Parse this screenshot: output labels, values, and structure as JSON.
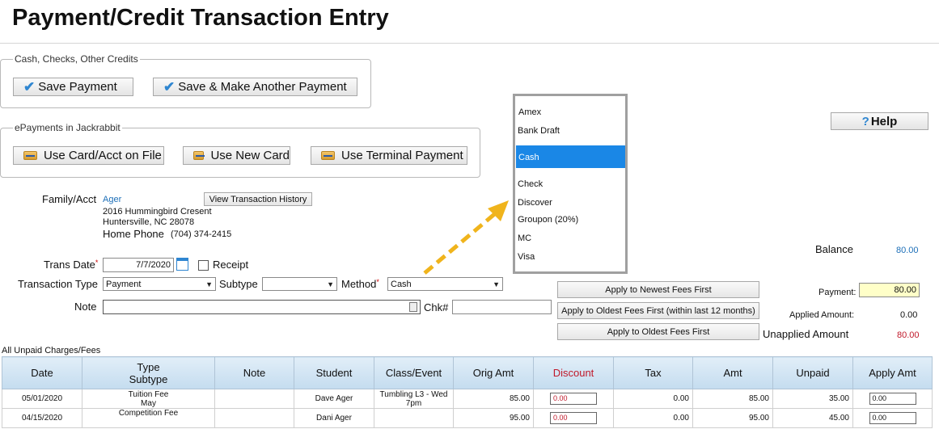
{
  "page": {
    "title": "Payment/Credit Transaction Entry"
  },
  "cash_section": {
    "legend": "Cash, Checks, Other Credits",
    "save_label": "Save Payment",
    "save_another_label": "Save & Make Another Payment"
  },
  "epay_section": {
    "legend": "ePayments in Jackrabbit",
    "card_on_file_label": "Use Card/Acct on File",
    "new_card_label": "Use New Card",
    "terminal_label": "Use Terminal Payment"
  },
  "help_label": "Help",
  "method_options": [
    {
      "label": "Amex"
    },
    {
      "label": "Bank Draft"
    },
    {
      "label": "Cash",
      "selected": true
    },
    {
      "label": "Check"
    },
    {
      "label": "Discover"
    },
    {
      "label": "Groupon (20%)"
    },
    {
      "label": "MC"
    },
    {
      "label": "Visa"
    }
  ],
  "family": {
    "label": "Family/Acct",
    "name": "Ager",
    "history_button": "View Transaction History",
    "address1": "2016 Hummingbird Cresent",
    "address2": "Huntersville, NC  28078",
    "home_phone_label": "Home Phone",
    "home_phone": "(704) 374-2415"
  },
  "form": {
    "trans_date_label": "Trans Date",
    "trans_date": "7/7/2020",
    "receipt_label": "Receipt",
    "transaction_type_label": "Transaction Type",
    "transaction_type": "Payment",
    "subtype_label": "Subtype",
    "subtype": "",
    "method_label": "Method",
    "method": "Cash",
    "note_label": "Note",
    "note": "",
    "chk_label": "Chk#",
    "chk": ""
  },
  "apply_buttons": {
    "newest": "Apply to Newest Fees First",
    "oldest_12": "Apply to Oldest Fees First (within last 12 months)",
    "oldest": "Apply to Oldest Fees First"
  },
  "summary": {
    "balance_label": "Balance",
    "balance": "80.00",
    "payment_label": "Payment:",
    "payment": "80.00",
    "applied_label": "Applied Amount:",
    "applied": "0.00",
    "unapplied_label": "Unapplied Amount",
    "unapplied": "80.00"
  },
  "charges": {
    "caption": "All Unpaid Charges/Fees",
    "headers": {
      "date": "Date",
      "type": "Type",
      "subtype": "Subtype",
      "note": "Note",
      "student": "Student",
      "class": "Class/Event",
      "orig": "Orig Amt",
      "discount": "Discount",
      "tax": "Tax",
      "amt": "Amt",
      "unpaid": "Unpaid",
      "apply": "Apply Amt"
    },
    "rows": [
      {
        "date": "05/01/2020",
        "type": "Tuition Fee",
        "subtype": "May",
        "note": "",
        "student": "Dave Ager",
        "class": "Tumbling L3 - Wed 7pm",
        "orig": "85.00",
        "discount": "0.00",
        "tax": "0.00",
        "amt": "85.00",
        "unpaid": "35.00",
        "apply": "0.00"
      },
      {
        "date": "04/15/2020",
        "type": "Competition Fee",
        "subtype": "",
        "note": "",
        "student": "Dani Ager",
        "class": "",
        "orig": "95.00",
        "discount": "0.00",
        "tax": "0.00",
        "amt": "95.00",
        "unpaid": "45.00",
        "apply": "0.00"
      }
    ]
  },
  "colors": {
    "link": "#1d6fb8",
    "selected_option": "#1a87e6",
    "arrow": "#f0b41c",
    "payment_field": "#ffffc8",
    "discount_red": "#c0192a",
    "header_blue": "#c4dcef"
  }
}
